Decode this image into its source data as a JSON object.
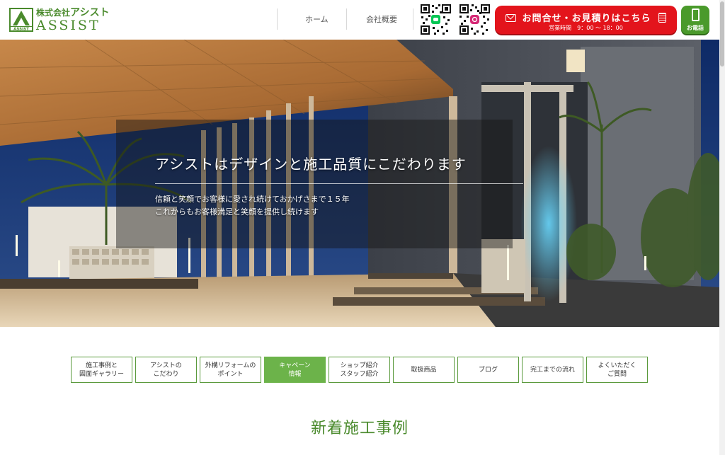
{
  "header": {
    "logo": {
      "mark": "A",
      "mark_sub": "ASSIST",
      "company_prefix": "株式会社",
      "company_name": "アシスト",
      "brand": "ASSIST"
    },
    "nav": [
      {
        "label": "ホーム"
      },
      {
        "label": "会社概要"
      }
    ],
    "qr_codes": [
      {
        "icon": "line-icon",
        "color": "#06c755"
      },
      {
        "icon": "instagram-icon",
        "color": "#d62976"
      }
    ],
    "contact": {
      "label": "お問合せ・お見積りはこちら",
      "hours": "営業時間　9：00 ～ 18：00",
      "color": "#e3141c"
    },
    "phone": {
      "label": "お電話",
      "color": "#4a9a2b"
    }
  },
  "hero": {
    "title": "アシストはデザインと施工品質にこだわります",
    "lines": [
      "信頼と笑顔でお客様に愛され続けておかげさまで１５年",
      "これからもお客様満足と笑顔を提供し続けます"
    ]
  },
  "menu": {
    "items": [
      {
        "label": "施工事例と\n図面ギャラリー",
        "active": false
      },
      {
        "label": "アシストの\nこだわり",
        "active": false
      },
      {
        "label": "外構リフォームの\nポイント",
        "active": false
      },
      {
        "label": "キャペーン\n情報",
        "active": true
      },
      {
        "label": "ショップ紹介\nスタッフ紹介",
        "active": false
      },
      {
        "label": "取扱商品",
        "active": false
      },
      {
        "label": "ブログ",
        "active": false
      },
      {
        "label": "完工までの流れ",
        "active": false
      },
      {
        "label": "よくいただく\nご質問",
        "active": false
      }
    ],
    "accent": "#6cb34a"
  },
  "section": {
    "title": "新着施工事例"
  }
}
